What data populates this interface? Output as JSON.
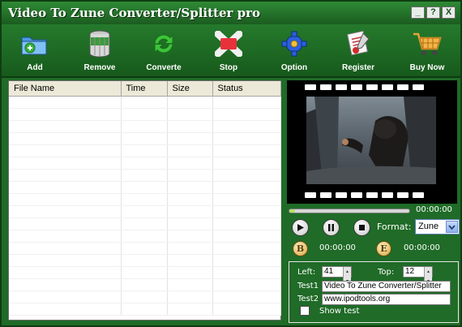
{
  "window": {
    "title": "Video To Zune Converter/Splitter pro",
    "buttons": {
      "minimize": "_",
      "help": "?",
      "close": "X"
    }
  },
  "toolbar": {
    "items": [
      {
        "label": "Add",
        "icon": "folder-add-icon"
      },
      {
        "label": "Remove",
        "icon": "trash-can-icon"
      },
      {
        "label": "Converte",
        "icon": "convert-arrows-icon"
      },
      {
        "label": "Stop",
        "icon": "stop-x-icon"
      },
      {
        "label": "Option",
        "icon": "gear-icon"
      },
      {
        "label": "Register",
        "icon": "register-certificate-icon"
      },
      {
        "label": "Buy Now",
        "icon": "shopping-cart-icon"
      }
    ]
  },
  "file_list": {
    "columns": [
      "File Name",
      "Time",
      "Size",
      "Status"
    ],
    "rows": []
  },
  "player": {
    "progress": 0.0,
    "current_time": "00:00:00",
    "format_label": "Format:",
    "format_value": "Zune",
    "begin_marker": "B",
    "begin_time": "00:00:00",
    "end_marker": "E",
    "end_time": "00:00:00"
  },
  "watermark": {
    "left_label": "Left:",
    "left_value": "41",
    "top_label": "Top:",
    "top_value": "12",
    "text1_label": "Test1",
    "text1_value": "Video To Zune Converter/Splitter",
    "text2_label": "Test2",
    "text2_value": "www.ipodtools.org",
    "show_text_label": "Show test",
    "show_text_checked": false
  },
  "colors": {
    "window_green": "#1f6b27",
    "header_gray": "#ece9d8",
    "seek_fill": "#b7e36a"
  }
}
